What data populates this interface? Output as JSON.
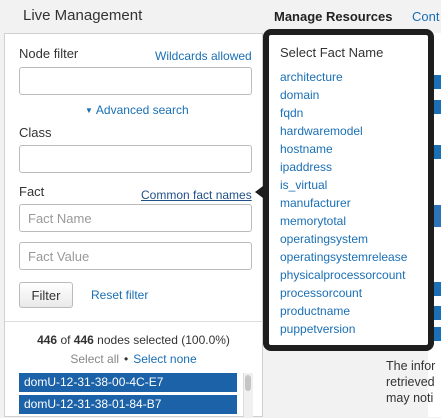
{
  "header": {
    "title": "Live Management",
    "manage_resources": "Manage Resources",
    "cont_truncated": "Cont"
  },
  "sidebar": {
    "node_filter_label": "Node filter",
    "wildcards_link": "Wildcards allowed",
    "node_filter_value": "",
    "advanced_search": "Advanced search",
    "class_label": "Class",
    "class_value": "",
    "fact_label": "Fact",
    "common_fact_names": "Common fact names",
    "fact_name_placeholder": "Fact Name",
    "fact_value_placeholder": "Fact Value",
    "filter_button": "Filter",
    "reset_filter": "Reset filter",
    "nodes_selected_count": "446",
    "nodes_of": "of",
    "nodes_total": "446",
    "nodes_selected_suffix": "nodes selected (100.0%)",
    "select_all": "Select all",
    "select_none": "Select none",
    "nodes": [
      "domU-12-31-38-00-4C-E7",
      "domU-12-31-38-01-84-B7"
    ]
  },
  "popover": {
    "title": "Select Fact Name",
    "facts": [
      "architecture",
      "domain",
      "fqdn",
      "hardwaremodel",
      "hostname",
      "ipaddress",
      "is_virtual",
      "manufacturer",
      "memorytotal",
      "operatingsystem",
      "operatingsystemrelease",
      "physicalprocessorcount",
      "processorcount",
      "productname",
      "puppetversion"
    ]
  },
  "right_pane": {
    "info_line1": "The infor",
    "info_line2": "retrieved",
    "info_line3": "may noti"
  },
  "colors": {
    "link": "#1a6fb5",
    "selected_row": "#1c62a8",
    "popover_border": "#1e1e1e"
  }
}
